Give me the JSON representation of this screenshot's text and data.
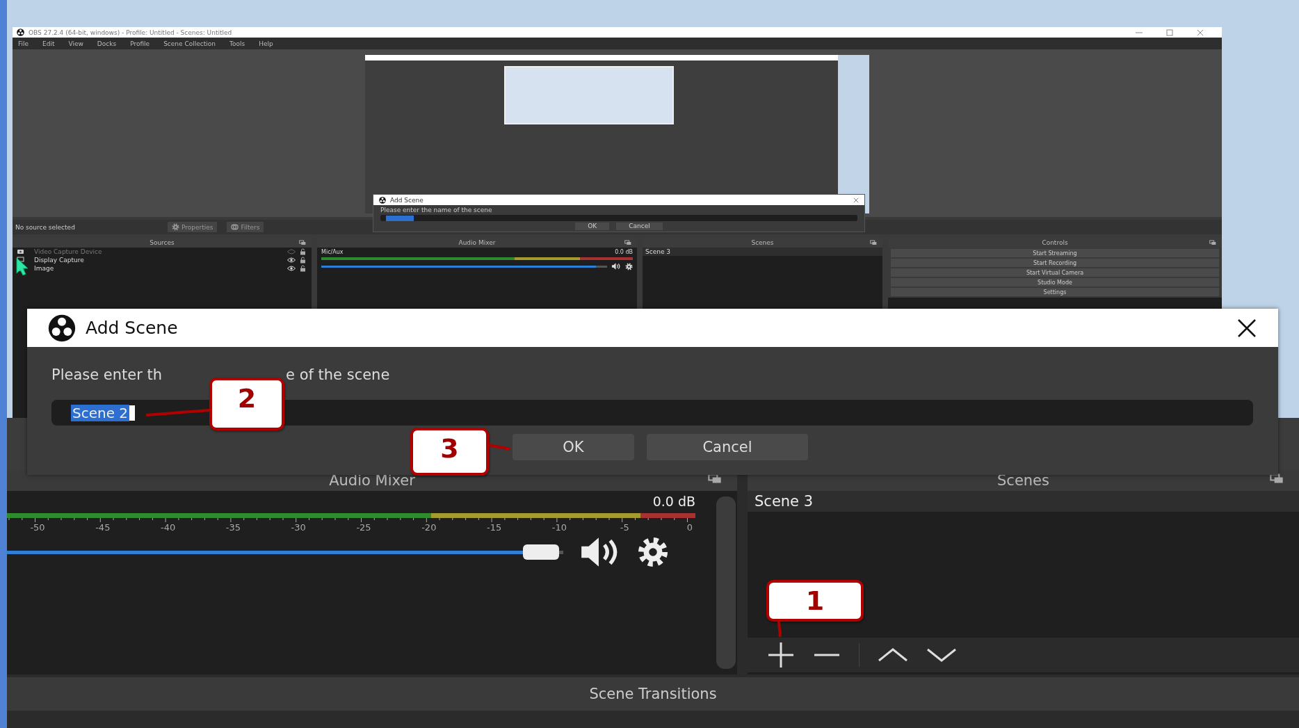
{
  "window": {
    "title": "OBS 27.2.4 (64-bit, windows) - Profile: Untitled - Scenes: Untitled"
  },
  "menu": [
    "File",
    "Edit",
    "View",
    "Docks",
    "Profile",
    "Scene Collection",
    "Tools",
    "Help"
  ],
  "preview": {
    "nested_dialog": {
      "title": "Add Scene",
      "prompt": "Please enter the name of the scene",
      "buttons": [
        "OK",
        "Cancel"
      ]
    }
  },
  "source_bar": {
    "status": "No source selected",
    "buttons": [
      "Properties",
      "Filters"
    ]
  },
  "inner_docks": {
    "titles": [
      "Sources",
      "Audio Mixer",
      "Scenes",
      "Controls"
    ],
    "sources": [
      {
        "name": "Video Capture Device",
        "kind": "camera",
        "visible": false
      },
      {
        "name": "Display Capture",
        "kind": "monitor",
        "visible": true
      },
      {
        "name": "Image",
        "kind": "image",
        "visible": true
      }
    ],
    "mixer": {
      "channel": "Mic/Aux",
      "reading": "0.0 dB",
      "level": 0.96
    },
    "scenes": [
      {
        "name": "Scene 3",
        "selected": true
      }
    ],
    "controls": [
      "Start Streaming",
      "Start Recording",
      "Start Virtual Camera",
      "Studio Mode",
      "Settings"
    ]
  },
  "dialog": {
    "title": "Add Scene",
    "prompt_parts": [
      "Please enter th",
      "e of the scene"
    ],
    "value": "Scene 2",
    "text_selected": true,
    "buttons": [
      {
        "label": "OK"
      },
      {
        "label": "Cancel"
      }
    ]
  },
  "docks": {
    "titles": [
      "Audio Mixer",
      "Scenes"
    ],
    "mixer": {
      "reading": "0.0 dB",
      "ticks": [
        "-50",
        "-45",
        "-40",
        "-35",
        "-30",
        "-25",
        "-20",
        "-15",
        "-10",
        "-5",
        "0"
      ],
      "level": 0.96
    },
    "scenes": [
      {
        "name": "Scene 3",
        "selected": true
      }
    ],
    "transitions_title": "Scene Transitions"
  },
  "callouts": [
    {
      "number": "1"
    },
    {
      "number": "2"
    },
    {
      "number": "3"
    }
  ]
}
